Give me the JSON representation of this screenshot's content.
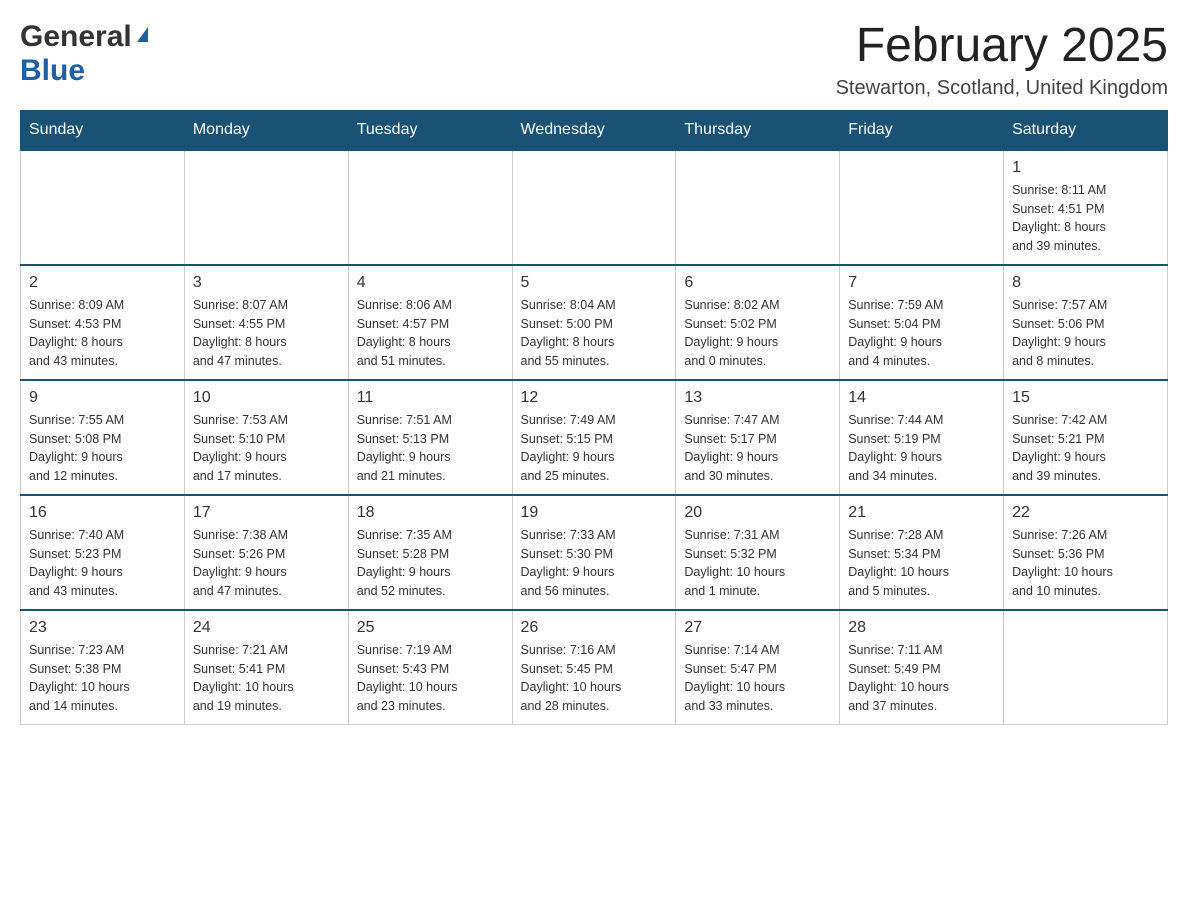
{
  "header": {
    "logo_general": "General",
    "logo_blue": "Blue",
    "month_title": "February 2025",
    "location": "Stewarton, Scotland, United Kingdom"
  },
  "days_of_week": [
    "Sunday",
    "Monday",
    "Tuesday",
    "Wednesday",
    "Thursday",
    "Friday",
    "Saturday"
  ],
  "weeks": [
    [
      {
        "day": "",
        "info": ""
      },
      {
        "day": "",
        "info": ""
      },
      {
        "day": "",
        "info": ""
      },
      {
        "day": "",
        "info": ""
      },
      {
        "day": "",
        "info": ""
      },
      {
        "day": "",
        "info": ""
      },
      {
        "day": "1",
        "info": "Sunrise: 8:11 AM\nSunset: 4:51 PM\nDaylight: 8 hours\nand 39 minutes."
      }
    ],
    [
      {
        "day": "2",
        "info": "Sunrise: 8:09 AM\nSunset: 4:53 PM\nDaylight: 8 hours\nand 43 minutes."
      },
      {
        "day": "3",
        "info": "Sunrise: 8:07 AM\nSunset: 4:55 PM\nDaylight: 8 hours\nand 47 minutes."
      },
      {
        "day": "4",
        "info": "Sunrise: 8:06 AM\nSunset: 4:57 PM\nDaylight: 8 hours\nand 51 minutes."
      },
      {
        "day": "5",
        "info": "Sunrise: 8:04 AM\nSunset: 5:00 PM\nDaylight: 8 hours\nand 55 minutes."
      },
      {
        "day": "6",
        "info": "Sunrise: 8:02 AM\nSunset: 5:02 PM\nDaylight: 9 hours\nand 0 minutes."
      },
      {
        "day": "7",
        "info": "Sunrise: 7:59 AM\nSunset: 5:04 PM\nDaylight: 9 hours\nand 4 minutes."
      },
      {
        "day": "8",
        "info": "Sunrise: 7:57 AM\nSunset: 5:06 PM\nDaylight: 9 hours\nand 8 minutes."
      }
    ],
    [
      {
        "day": "9",
        "info": "Sunrise: 7:55 AM\nSunset: 5:08 PM\nDaylight: 9 hours\nand 12 minutes."
      },
      {
        "day": "10",
        "info": "Sunrise: 7:53 AM\nSunset: 5:10 PM\nDaylight: 9 hours\nand 17 minutes."
      },
      {
        "day": "11",
        "info": "Sunrise: 7:51 AM\nSunset: 5:13 PM\nDaylight: 9 hours\nand 21 minutes."
      },
      {
        "day": "12",
        "info": "Sunrise: 7:49 AM\nSunset: 5:15 PM\nDaylight: 9 hours\nand 25 minutes."
      },
      {
        "day": "13",
        "info": "Sunrise: 7:47 AM\nSunset: 5:17 PM\nDaylight: 9 hours\nand 30 minutes."
      },
      {
        "day": "14",
        "info": "Sunrise: 7:44 AM\nSunset: 5:19 PM\nDaylight: 9 hours\nand 34 minutes."
      },
      {
        "day": "15",
        "info": "Sunrise: 7:42 AM\nSunset: 5:21 PM\nDaylight: 9 hours\nand 39 minutes."
      }
    ],
    [
      {
        "day": "16",
        "info": "Sunrise: 7:40 AM\nSunset: 5:23 PM\nDaylight: 9 hours\nand 43 minutes."
      },
      {
        "day": "17",
        "info": "Sunrise: 7:38 AM\nSunset: 5:26 PM\nDaylight: 9 hours\nand 47 minutes."
      },
      {
        "day": "18",
        "info": "Sunrise: 7:35 AM\nSunset: 5:28 PM\nDaylight: 9 hours\nand 52 minutes."
      },
      {
        "day": "19",
        "info": "Sunrise: 7:33 AM\nSunset: 5:30 PM\nDaylight: 9 hours\nand 56 minutes."
      },
      {
        "day": "20",
        "info": "Sunrise: 7:31 AM\nSunset: 5:32 PM\nDaylight: 10 hours\nand 1 minute."
      },
      {
        "day": "21",
        "info": "Sunrise: 7:28 AM\nSunset: 5:34 PM\nDaylight: 10 hours\nand 5 minutes."
      },
      {
        "day": "22",
        "info": "Sunrise: 7:26 AM\nSunset: 5:36 PM\nDaylight: 10 hours\nand 10 minutes."
      }
    ],
    [
      {
        "day": "23",
        "info": "Sunrise: 7:23 AM\nSunset: 5:38 PM\nDaylight: 10 hours\nand 14 minutes."
      },
      {
        "day": "24",
        "info": "Sunrise: 7:21 AM\nSunset: 5:41 PM\nDaylight: 10 hours\nand 19 minutes."
      },
      {
        "day": "25",
        "info": "Sunrise: 7:19 AM\nSunset: 5:43 PM\nDaylight: 10 hours\nand 23 minutes."
      },
      {
        "day": "26",
        "info": "Sunrise: 7:16 AM\nSunset: 5:45 PM\nDaylight: 10 hours\nand 28 minutes."
      },
      {
        "day": "27",
        "info": "Sunrise: 7:14 AM\nSunset: 5:47 PM\nDaylight: 10 hours\nand 33 minutes."
      },
      {
        "day": "28",
        "info": "Sunrise: 7:11 AM\nSunset: 5:49 PM\nDaylight: 10 hours\nand 37 minutes."
      },
      {
        "day": "",
        "info": ""
      }
    ]
  ]
}
